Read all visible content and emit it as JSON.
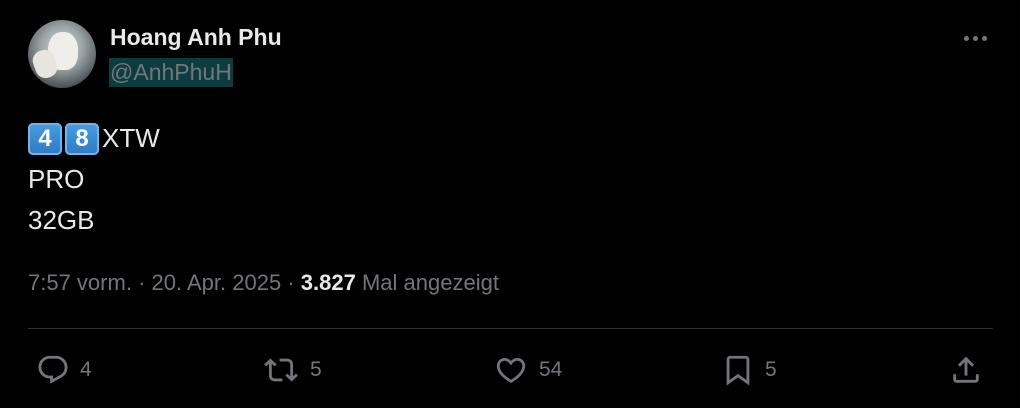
{
  "author": {
    "display_name": "Hoang Anh Phu",
    "handle": "@AnhPhuH"
  },
  "tweet": {
    "keycaps": [
      "4",
      "8"
    ],
    "line1_suffix": "XTW",
    "line2": "PRO",
    "line3": "32GB"
  },
  "meta": {
    "time": "7:57 vorm.",
    "sep1": "·",
    "date": "20. Apr. 2025",
    "sep2": "·",
    "views_count": "3.827",
    "views_label": "Mal angezeigt"
  },
  "actions": {
    "replies": "4",
    "reposts": "5",
    "likes": "54",
    "bookmarks": "5"
  },
  "icons": {
    "more": "more-horizontal-icon",
    "reply": "reply-icon",
    "repost": "repost-icon",
    "like": "heart-icon",
    "bookmark": "bookmark-icon",
    "share": "share-icon"
  },
  "colors": {
    "background": "#000000",
    "text": "#e7e9ea",
    "secondary": "#71767b",
    "divider": "#2f3336",
    "handle_highlight": "#0b3c40"
  }
}
